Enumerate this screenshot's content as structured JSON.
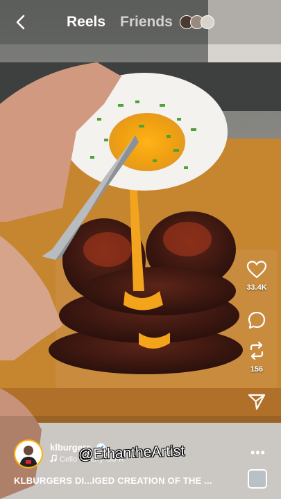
{
  "header": {
    "tab_reels": "Reels",
    "tab_friends": "Friends"
  },
  "rail": {
    "likes": "33.4K",
    "shares": "156"
  },
  "post": {
    "username": "klburgers",
    "audio_text": "Cello · Merry-Go-R",
    "caption": "KLBURGERS DI...IGED CREATION OF THE ..."
  },
  "overlay": {
    "watermark": "@EthantheArtist"
  },
  "colors": {
    "avatar_ring": "#ffb100",
    "verified": "#3897f0"
  },
  "icons": [
    "back-arrow-icon",
    "heart-icon",
    "comment-icon",
    "repost-icon",
    "send-icon",
    "music-note-icon",
    "verified-icon",
    "more-icon"
  ]
}
